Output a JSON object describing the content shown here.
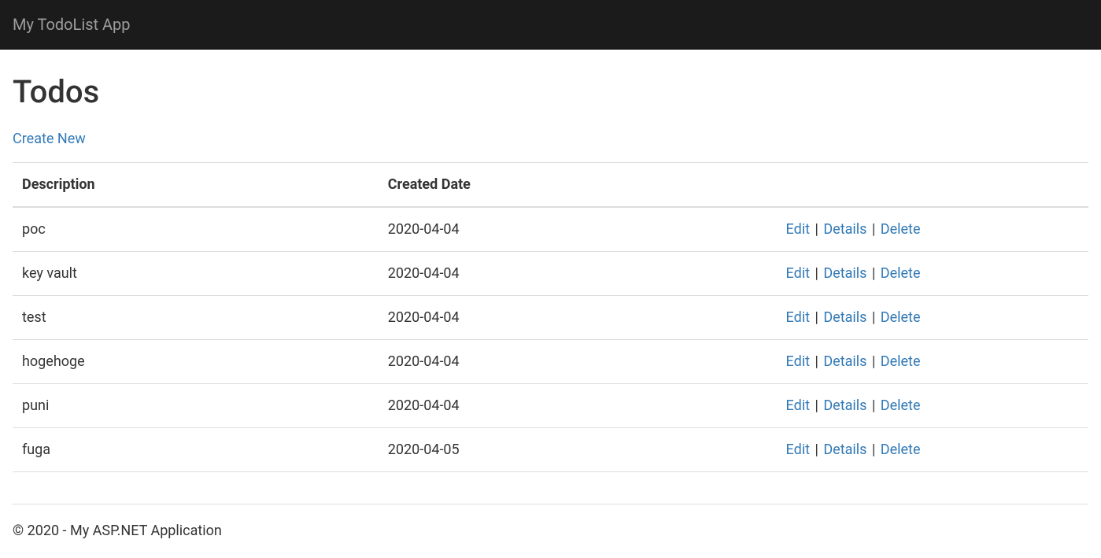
{
  "navbar": {
    "brand": "My TodoList App"
  },
  "main": {
    "title": "Todos",
    "create_label": "Create New",
    "columns": {
      "description": "Description",
      "created_date": "Created Date"
    },
    "rows": [
      {
        "description": "poc",
        "created_date": "2020-04-04"
      },
      {
        "description": "key vault",
        "created_date": "2020-04-04"
      },
      {
        "description": "test",
        "created_date": "2020-04-04"
      },
      {
        "description": "hogehoge",
        "created_date": "2020-04-04"
      },
      {
        "description": "puni",
        "created_date": "2020-04-04"
      },
      {
        "description": "fuga",
        "created_date": "2020-04-05"
      }
    ],
    "actions": {
      "edit": "Edit",
      "details": "Details",
      "delete": "Delete",
      "separator": "|"
    }
  },
  "footer": {
    "text": "© 2020 - My ASP.NET Application"
  }
}
